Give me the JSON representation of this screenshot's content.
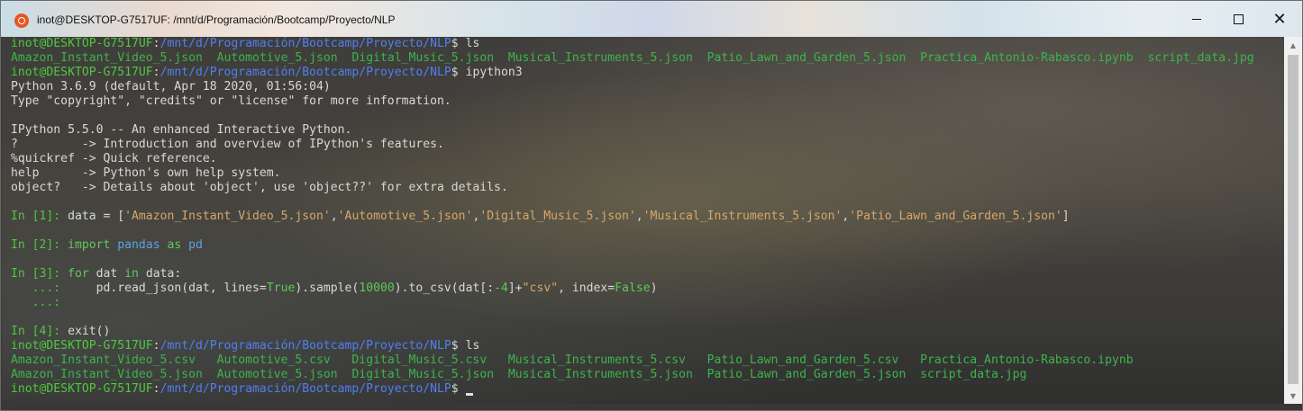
{
  "window": {
    "title": "inot@DESKTOP-G7517UF: /mnt/d/Programación/Bootcamp/Proyecto/NLP",
    "app_icon": "ubuntu-icon",
    "controls": {
      "minimize": "minimize-icon",
      "maximize": "maximize-icon",
      "close": "✕"
    }
  },
  "prompt": {
    "user_host": "inot@DESKTOP-G7517UF",
    "path": "/mnt/d/Programación/Bootcamp/Proyecto/NLP",
    "symbol": "$"
  },
  "terminal": {
    "cmd1": "ls",
    "ls1": [
      "Amazon_Instant_Video_5.json",
      "Automotive_5.json",
      "Digital_Music_5.json",
      "Musical_Instruments_5.json",
      "Patio_Lawn_and_Garden_5.json",
      "Practica_Antonio-Rabasco.ipynb",
      "script_data.jpg"
    ],
    "cmd2": "ipython3",
    "py_version": "Python 3.6.9 (default, Apr 18 2020, 01:56:04)",
    "py_help": "Type \"copyright\", \"credits\" or \"license\" for more information.",
    "ipy_version": "IPython 5.5.0 -- An enhanced Interactive Python.",
    "help_lines": [
      "?         -> Introduction and overview of IPython's features.",
      "%quickref -> Quick reference.",
      "help      -> Python's own help system.",
      "object?   -> Details about 'object', use 'object??' for extra details."
    ],
    "in1_prompt": "In [1]: ",
    "in1_var": "data = [",
    "in1_strings": [
      "'Amazon_Instant_Video_5.json'",
      "'Automotive_5.json'",
      "'Digital_Music_5.json'",
      "'Musical_Instruments_5.json'",
      "'Patio_Lawn_and_Garden_5.json'"
    ],
    "in1_close": "]",
    "in2_prompt": "In [2]: ",
    "in2_import": "import",
    "in2_mod": "pandas",
    "in2_as": "as",
    "in2_alias": "pd",
    "in3_prompt": "In [3]: ",
    "in3_for": "for",
    "in3_var": " dat ",
    "in3_in": "in",
    "in3_rest": " data:",
    "cont_prompt": "   ...:     ",
    "in3_l2_a": "pd.read_json(dat, lines=",
    "in3_true": "True",
    "in3_l2_b": ").sample(",
    "in3_num": "10000",
    "in3_l2_c": ").to_csv(dat[:",
    "in3_neg": "-4",
    "in3_l2_d": "]+",
    "in3_csv": "\"csv\"",
    "in3_l2_e": ", index=",
    "in3_false": "False",
    "in3_l2_f": ")",
    "cont_empty": "   ...:",
    "in4_prompt": "In [4]: ",
    "in4_cmd": "exit()",
    "cmd3": "ls",
    "ls2_row1": [
      "Amazon_Instant_Video_5.csv",
      "Automotive_5.csv",
      "Digital_Music_5.csv",
      "Musical_Instruments_5.csv",
      "Patio_Lawn_and_Garden_5.csv",
      "Practica_Antonio-Rabasco.ipynb"
    ],
    "ls2_row2": [
      "Amazon_Instant_Video_5.json",
      "Automotive_5.json",
      "Digital_Music_5.json",
      "Musical_Instruments_5.json",
      "Patio_Lawn_and_Garden_5.json",
      "script_data.jpg"
    ]
  },
  "scrollbar": {
    "up": "▲",
    "down": "▼"
  },
  "colors": {
    "prompt_user": "#4fc83d",
    "prompt_path": "#4f7ff2",
    "string": "#d7a66a",
    "keyword": "#5fc85a"
  }
}
